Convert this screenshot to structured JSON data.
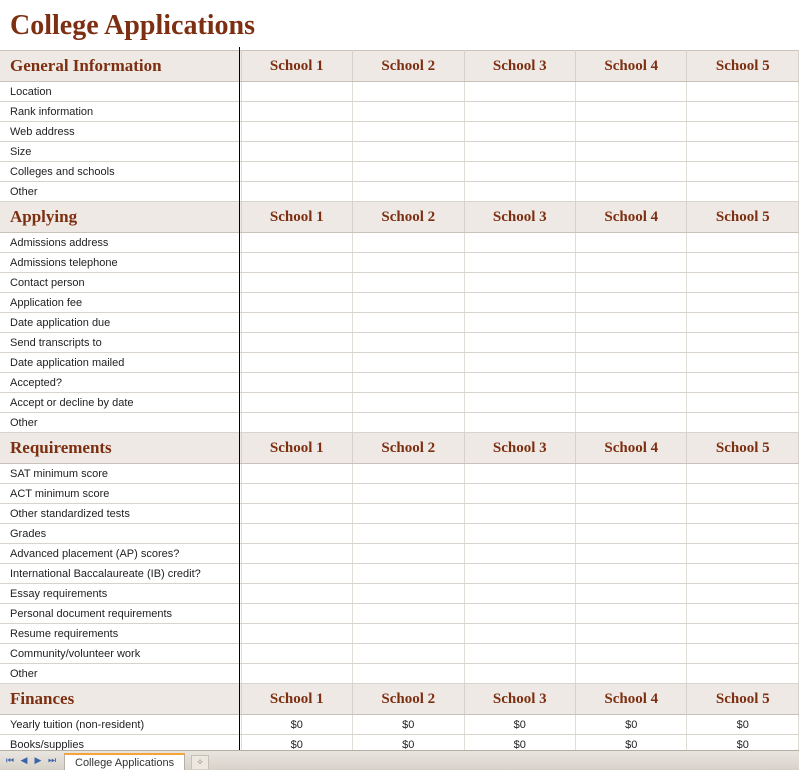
{
  "title": "College Applications",
  "schools": [
    "School 1",
    "School 2",
    "School 3",
    "School 4",
    "School 5"
  ],
  "sections": [
    {
      "name": "General Information",
      "rows": [
        {
          "label": "Location",
          "values": [
            "",
            "",
            "",
            "",
            ""
          ]
        },
        {
          "label": "Rank information",
          "values": [
            "",
            "",
            "",
            "",
            ""
          ]
        },
        {
          "label": "Web address",
          "values": [
            "",
            "",
            "",
            "",
            ""
          ]
        },
        {
          "label": "Size",
          "values": [
            "",
            "",
            "",
            "",
            ""
          ]
        },
        {
          "label": "Colleges and schools",
          "values": [
            "",
            "",
            "",
            "",
            ""
          ]
        },
        {
          "label": "Other",
          "values": [
            "",
            "",
            "",
            "",
            ""
          ]
        }
      ]
    },
    {
      "name": "Applying",
      "rows": [
        {
          "label": "Admissions address",
          "values": [
            "",
            "",
            "",
            "",
            ""
          ]
        },
        {
          "label": "Admissions telephone",
          "values": [
            "",
            "",
            "",
            "",
            ""
          ]
        },
        {
          "label": "Contact person",
          "values": [
            "",
            "",
            "",
            "",
            ""
          ]
        },
        {
          "label": "Application fee",
          "values": [
            "",
            "",
            "",
            "",
            ""
          ]
        },
        {
          "label": "Date application due",
          "values": [
            "",
            "",
            "",
            "",
            ""
          ]
        },
        {
          "label": "Send transcripts to",
          "values": [
            "",
            "",
            "",
            "",
            ""
          ]
        },
        {
          "label": "Date application mailed",
          "values": [
            "",
            "",
            "",
            "",
            ""
          ]
        },
        {
          "label": "Accepted?",
          "values": [
            "",
            "",
            "",
            "",
            ""
          ]
        },
        {
          "label": "Accept or decline by date",
          "values": [
            "",
            "",
            "",
            "",
            ""
          ]
        },
        {
          "label": "Other",
          "values": [
            "",
            "",
            "",
            "",
            ""
          ]
        }
      ]
    },
    {
      "name": "Requirements",
      "rows": [
        {
          "label": "SAT minimum score",
          "values": [
            "",
            "",
            "",
            "",
            ""
          ]
        },
        {
          "label": "ACT minimum score",
          "values": [
            "",
            "",
            "",
            "",
            ""
          ]
        },
        {
          "label": "Other standardized tests",
          "values": [
            "",
            "",
            "",
            "",
            ""
          ]
        },
        {
          "label": "Grades",
          "values": [
            "",
            "",
            "",
            "",
            ""
          ]
        },
        {
          "label": "Advanced placement (AP) scores?",
          "values": [
            "",
            "",
            "",
            "",
            ""
          ]
        },
        {
          "label": "International Baccalaureate (IB) credit?",
          "values": [
            "",
            "",
            "",
            "",
            ""
          ]
        },
        {
          "label": "Essay requirements",
          "values": [
            "",
            "",
            "",
            "",
            ""
          ]
        },
        {
          "label": "Personal document requirements",
          "values": [
            "",
            "",
            "",
            "",
            ""
          ]
        },
        {
          "label": "Resume requirements",
          "values": [
            "",
            "",
            "",
            "",
            ""
          ]
        },
        {
          "label": "Community/volunteer work",
          "values": [
            "",
            "",
            "",
            "",
            ""
          ]
        },
        {
          "label": "Other",
          "values": [
            "",
            "",
            "",
            "",
            ""
          ]
        }
      ]
    },
    {
      "name": "Finances",
      "rows": [
        {
          "label": "Yearly tuition (non-resident)",
          "values": [
            "$0",
            "$0",
            "$0",
            "$0",
            "$0"
          ]
        },
        {
          "label": "Books/supplies",
          "values": [
            "$0",
            "$0",
            "$0",
            "$0",
            "$0"
          ]
        }
      ]
    }
  ],
  "tabbar": {
    "active_tab": "College Applications"
  }
}
